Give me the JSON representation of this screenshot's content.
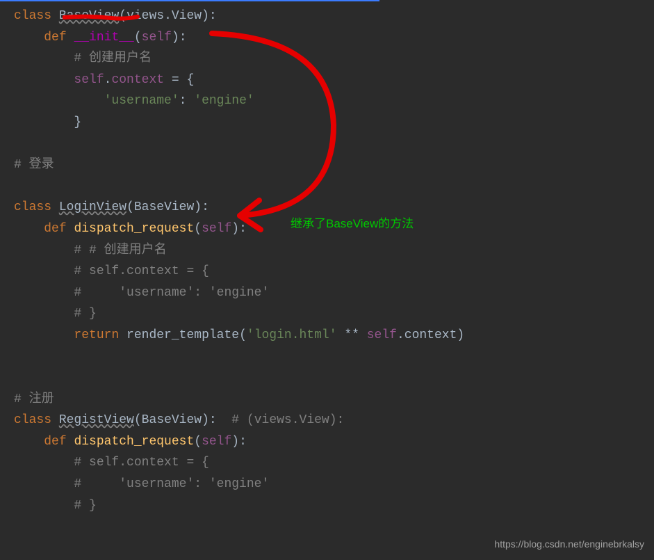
{
  "progress": {
    "width": "58%"
  },
  "lines": {
    "l1": {
      "kw": "class",
      "name": "BaseView",
      "paren_l": "(",
      "base": "views.View",
      "paren_r": "):"
    },
    "l2": {
      "indent": "    ",
      "kw": "def",
      "space": " ",
      "name": "__init__",
      "paren_l": "(",
      "param": "self",
      "paren_r": "):"
    },
    "l3": {
      "indent": "        ",
      "comment": "# 创建用户名"
    },
    "l4": {
      "indent": "        ",
      "selfw": "self",
      "dot": ".",
      "attr": "context",
      "eq": " = {",
      "rest": ""
    },
    "l5": {
      "indent": "            ",
      "key": "'username'",
      "colon": ": ",
      "val": "'engine'"
    },
    "l6": {
      "indent": "        ",
      "brace": "}"
    },
    "l7": {
      "comment": "# 登录"
    },
    "l8": {
      "kw": "class",
      "name": "LoginView",
      "paren_l": "(",
      "base": "BaseView",
      "paren_r": "):"
    },
    "l9": {
      "indent": "    ",
      "kw": "def",
      "space": " ",
      "name": "dispatch_request",
      "paren_l": "(",
      "param": "self",
      "paren_r": "):"
    },
    "l10": {
      "indent": "        ",
      "comment": "# # 创建用户名"
    },
    "l11": {
      "indent": "        ",
      "comment": "# self.context = {"
    },
    "l12": {
      "indent": "        ",
      "comment": "#     'username': 'engine'"
    },
    "l13": {
      "indent": "        ",
      "comment": "# }"
    },
    "l14": {
      "indent": "        ",
      "kw": "return",
      "space": " ",
      "call": "render_template",
      "paren_l": "(",
      "arg1": "'login.html'",
      "starstar": " ** ",
      "selfw": "self",
      "dot": ".",
      "attr": "context",
      "paren_r": ")"
    },
    "l15": {
      "comment": "# 注册"
    },
    "l16": {
      "kw": "class",
      "name": "RegistView",
      "paren_l": "(",
      "base": "BaseView",
      "paren_r": "):",
      "trail": "  # (views.View):"
    },
    "l17": {
      "indent": "    ",
      "kw": "def",
      "space": " ",
      "name": "dispatch_request",
      "paren_l": "(",
      "param": "self",
      "paren_r": "):"
    },
    "l18": {
      "indent": "        ",
      "comment": "# self.context = {"
    },
    "l19": {
      "indent": "        ",
      "comment": "#     'username': 'engine'"
    },
    "l20": {
      "indent": "        ",
      "comment": "# }"
    }
  },
  "annotation": {
    "text": "继承了BaseView的方法"
  },
  "watermark": {
    "text": "https://blog.csdn.net/enginebrkalsy"
  }
}
